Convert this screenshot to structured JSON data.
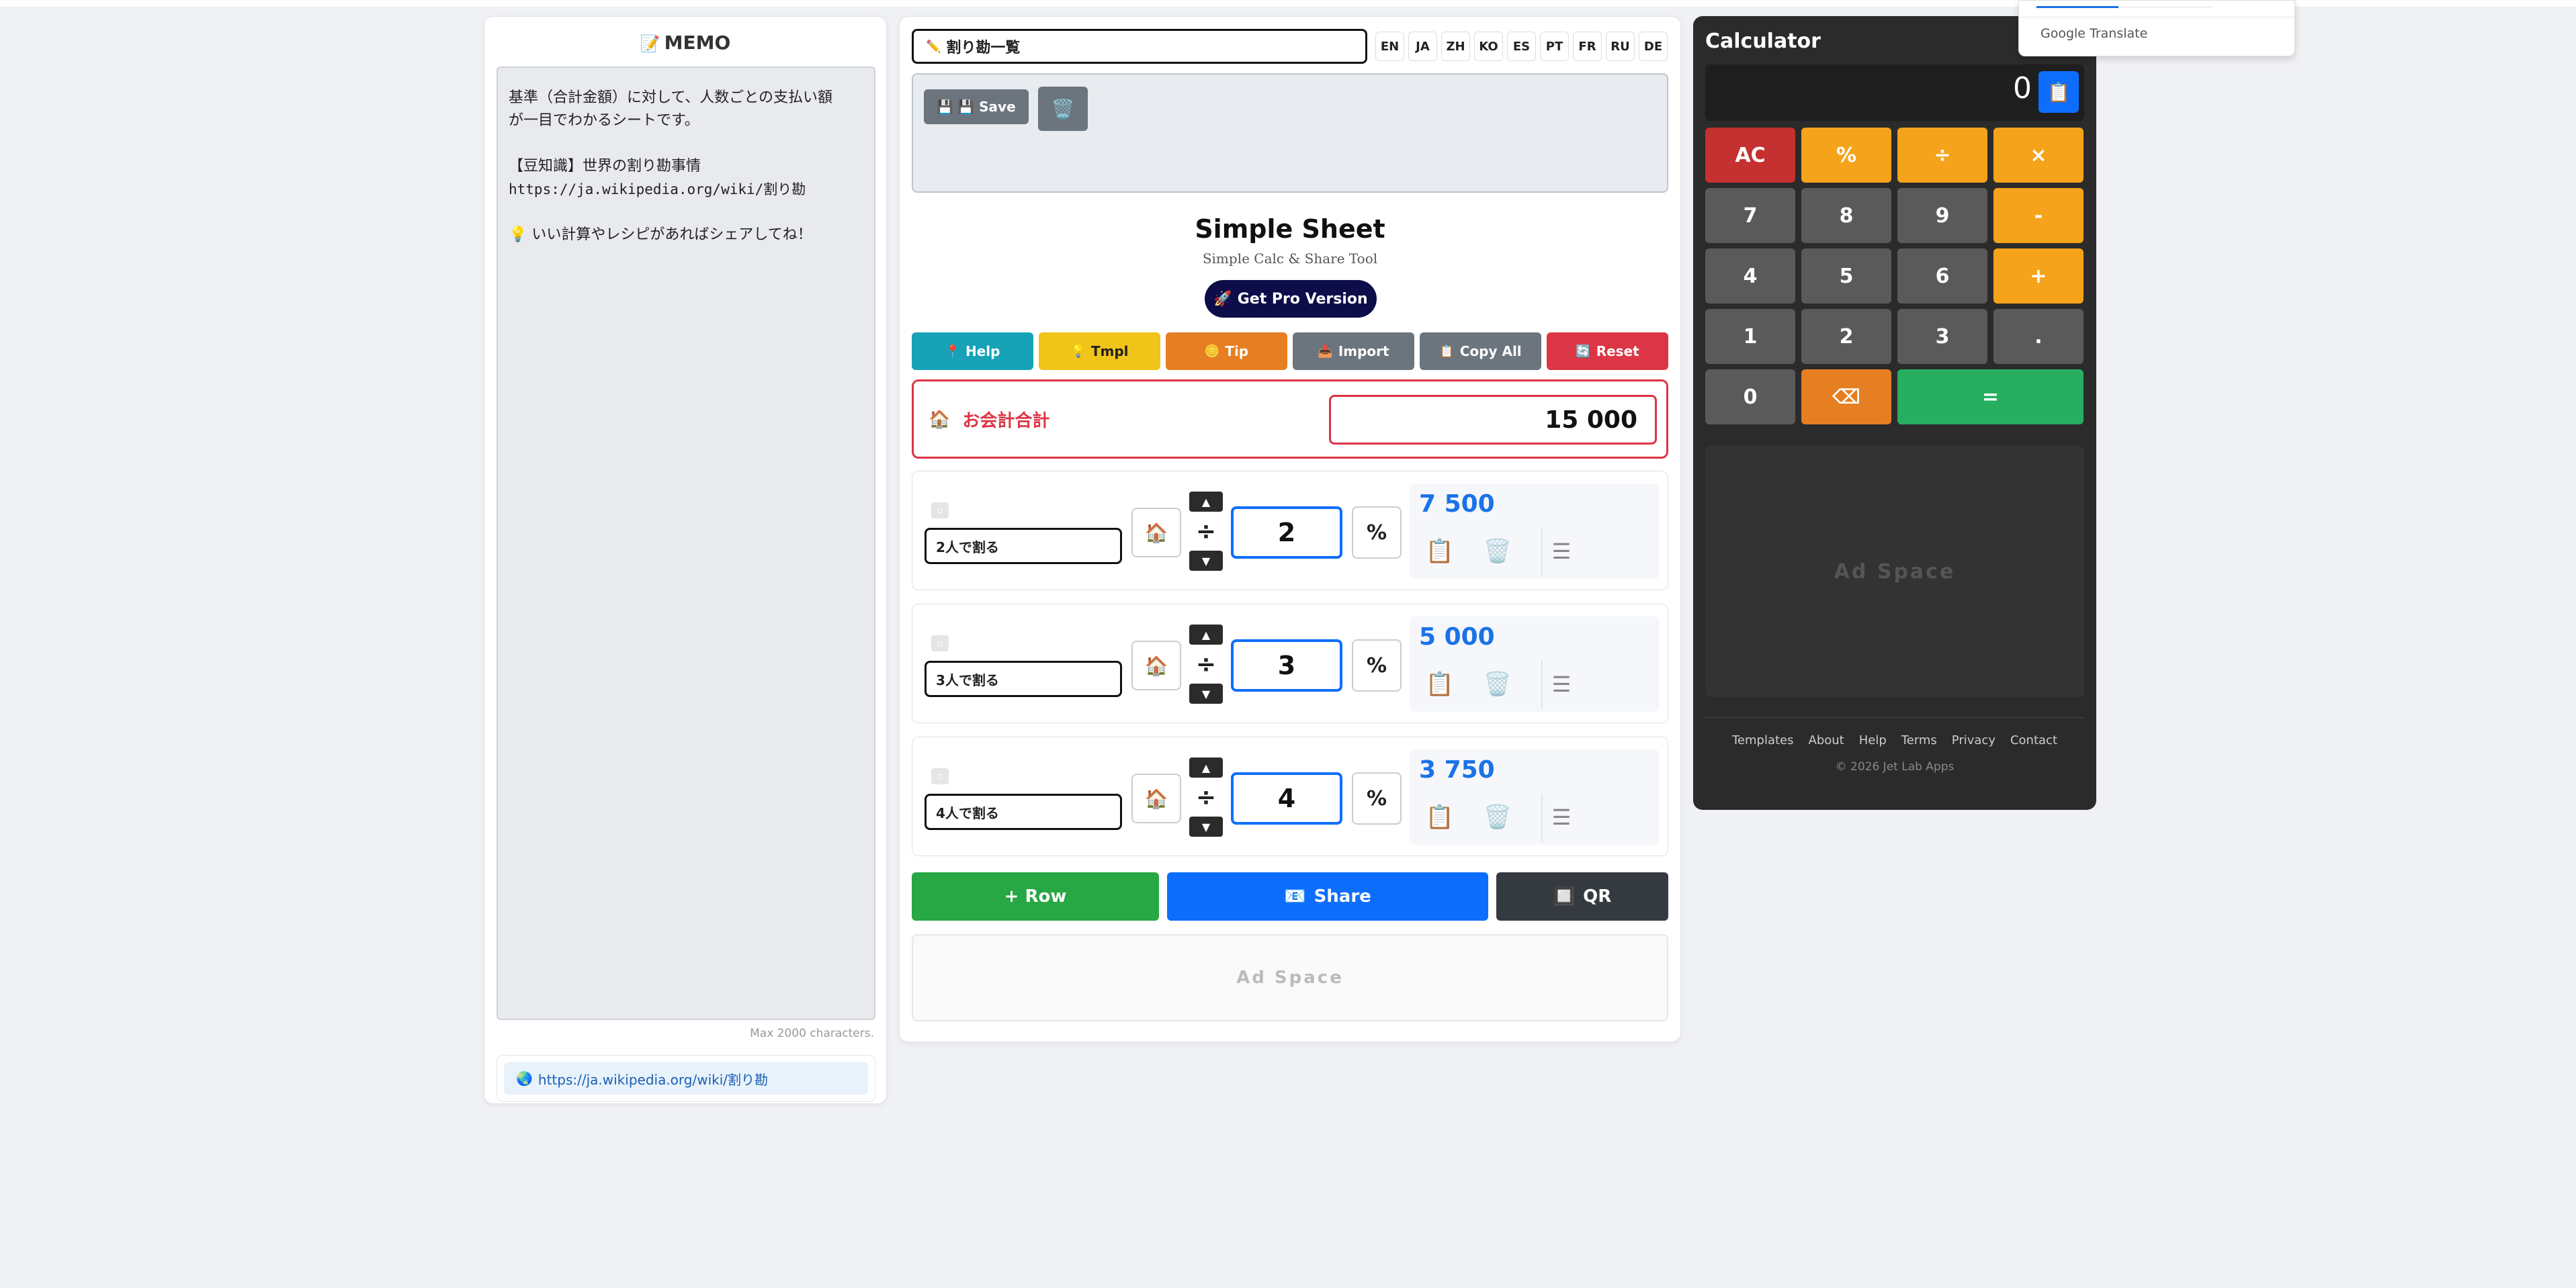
{
  "memo": {
    "title": "MEMO",
    "lines": [
      "基準（合計金額）に対して、人数ごとの支払い額",
      "が一目でわかるシートです。",
      "",
      "【豆知識】世界の割り勘事情",
      "https://ja.wikipedia.org/wiki/割り勘",
      "",
      "💡 いい計算やレシピがあればシェアしてね！"
    ],
    "max_note": "Max 2000 characters.",
    "link": "https://ja.wikipedia.org/wiki/割り勘"
  },
  "sheet": {
    "title_value": "割り勘一覧",
    "languages": [
      "EN",
      "JA",
      "ZH",
      "KO",
      "ES",
      "PT",
      "FR",
      "RU",
      "DE"
    ],
    "save_label": "💾 Save",
    "app_title": "Simple Sheet",
    "app_subtitle": "Simple Calc & Share Tool",
    "pro_label": "Get Pro Version",
    "toolbar": {
      "help": "Help",
      "tmpl": "Tmpl",
      "tip": "Tip",
      "import": "Import",
      "copy_all": "Copy All",
      "reset": "Reset"
    },
    "total": {
      "label": "お会計合計",
      "value": "15 000"
    },
    "rows": [
      {
        "label": "2人で割る",
        "operator": "÷",
        "value": "2",
        "result": "7 500"
      },
      {
        "label": "3人で割る",
        "operator": "÷",
        "value": "3",
        "result": "5 000"
      },
      {
        "label": "4人で割る",
        "operator": "÷",
        "value": "4",
        "result": "3 750"
      }
    ],
    "add_row": "+ Row",
    "share": "Share",
    "qr": "QR",
    "ad": "Ad Space"
  },
  "calculator": {
    "title": "Calculator",
    "display": "0",
    "keys": [
      [
        "AC",
        "%",
        "÷",
        "×"
      ],
      [
        "7",
        "8",
        "9",
        "-"
      ],
      [
        "4",
        "5",
        "6",
        "+"
      ],
      [
        "1",
        "2",
        "3",
        "."
      ],
      [
        "0",
        "⌫",
        "="
      ]
    ],
    "ad": "Ad Space",
    "footer_links": [
      "Templates",
      "About",
      "Help",
      "Terms",
      "Privacy",
      "Contact"
    ],
    "copyright": "© 2026 Jet Lab Apps"
  },
  "translate": {
    "brand": "Google Translate"
  },
  "colors": {
    "accent_blue": "#0d6efd",
    "danger_red": "#dc3545",
    "result_blue": "#1a73e8",
    "help_teal": "#17a2b8",
    "tmpl_yellow": "#f0c419",
    "tip_orange": "#e67e22",
    "gray": "#6c757d",
    "green": "#28a745",
    "dark": "#343a40"
  },
  "icons": {
    "memo": "memo-icon",
    "title": "pencil-icon",
    "save": "floppy-disk-icon",
    "trash": "trash-icon",
    "pro": "rocket-icon",
    "help": "pin-icon",
    "tmpl": "bulb-icon",
    "tip": "coin-icon",
    "import": "inbox-icon",
    "copy_all": "clipboard-icon",
    "reset": "refresh-icon",
    "total": "house-icon",
    "row_ref": "house-icon",
    "share": "envelope-icon",
    "qr": "qr-code-icon",
    "link": "globe-icon"
  }
}
